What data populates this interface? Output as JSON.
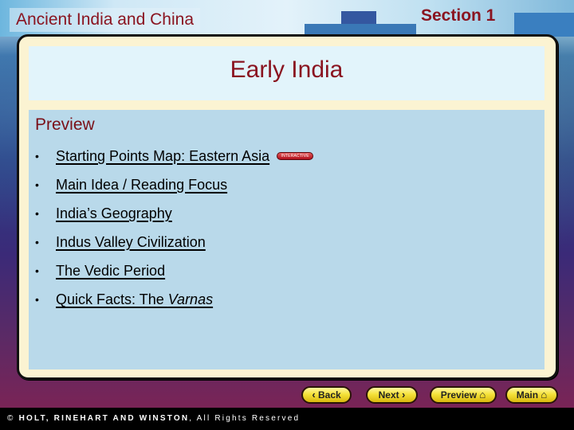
{
  "header": {
    "course_title": "Ancient India and China",
    "section_label": "Section 1"
  },
  "slide": {
    "title": "Early India",
    "content_heading": "Preview",
    "items": [
      {
        "label": "Starting Points Map: Eastern Asia",
        "badge": "INTERACTIVE"
      },
      {
        "label": "Main Idea / Reading Focus"
      },
      {
        "label": "India’s Geography"
      },
      {
        "label": "Indus Valley Civilization"
      },
      {
        "label": "The Vedic Period"
      },
      {
        "label_prefix": "Quick Facts: The ",
        "label_italic": "Varnas"
      }
    ],
    "bullet_glyph": "•"
  },
  "nav": {
    "back": {
      "label": "Back",
      "icon": "chevron-left-icon",
      "glyph": "‹"
    },
    "next": {
      "label": "Next",
      "icon": "chevron-right-icon",
      "glyph": "›"
    },
    "preview": {
      "label": "Preview",
      "icon": "home-icon",
      "glyph": "⌂"
    },
    "main": {
      "label": "Main",
      "icon": "home-icon",
      "glyph": "⌂"
    }
  },
  "footer": {
    "copyright_symbol": "©",
    "publisher": "HOLT, RINEHART AND WINSTON",
    "rights": ", All Rights Reserved"
  },
  "colors": {
    "title_red": "#8a1420",
    "panel_cream": "#fbf3d2",
    "title_box": "#e2f4fb",
    "content_box": "#b9d9ea",
    "button_yellow": "#f5e23a"
  }
}
